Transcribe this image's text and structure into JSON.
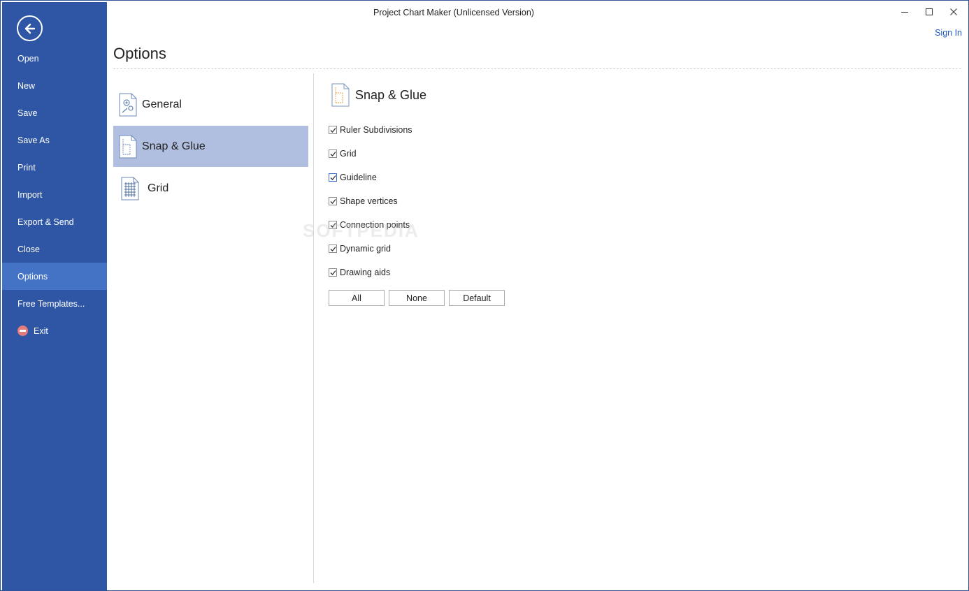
{
  "window": {
    "title": "Project Chart Maker (Unlicensed Version)",
    "sign_in": "Sign In"
  },
  "sidebar": {
    "back_icon": "arrow-left-circle-icon",
    "items": [
      {
        "label": "Open"
      },
      {
        "label": "New"
      },
      {
        "label": "Save"
      },
      {
        "label": "Save As"
      },
      {
        "label": "Print"
      },
      {
        "label": "Import"
      },
      {
        "label": "Export & Send"
      },
      {
        "label": "Close"
      },
      {
        "label": "Options",
        "active": true
      },
      {
        "label": "Free Templates..."
      },
      {
        "label": "Exit",
        "icon": "exit-icon"
      }
    ]
  },
  "options": {
    "title": "Options",
    "categories": [
      {
        "label": "General",
        "icon": "settings-page-icon"
      },
      {
        "label": "Snap & Glue",
        "icon": "snap-glue-page-icon",
        "selected": true
      },
      {
        "label": "Grid",
        "icon": "grid-page-icon"
      }
    ]
  },
  "panel": {
    "title": "Snap & Glue",
    "checks": [
      {
        "label": "Ruler Subdivisions",
        "checked": true
      },
      {
        "label": "Grid",
        "checked": true
      },
      {
        "label": "Guideline",
        "checked": true
      },
      {
        "label": "Shape vertices",
        "checked": true
      },
      {
        "label": "Connection points",
        "checked": true
      },
      {
        "label": "Dynamic grid",
        "checked": true
      },
      {
        "label": "Drawing aids",
        "checked": true
      }
    ],
    "buttons": {
      "all": "All",
      "none": "None",
      "default": "Default"
    }
  },
  "watermark": "SOFTPEDIA",
  "colors": {
    "sidebar": "#2f56a4",
    "sidebar_active": "#4472c4",
    "category_selected": "#b0bfe0",
    "link": "#1f56c2"
  }
}
